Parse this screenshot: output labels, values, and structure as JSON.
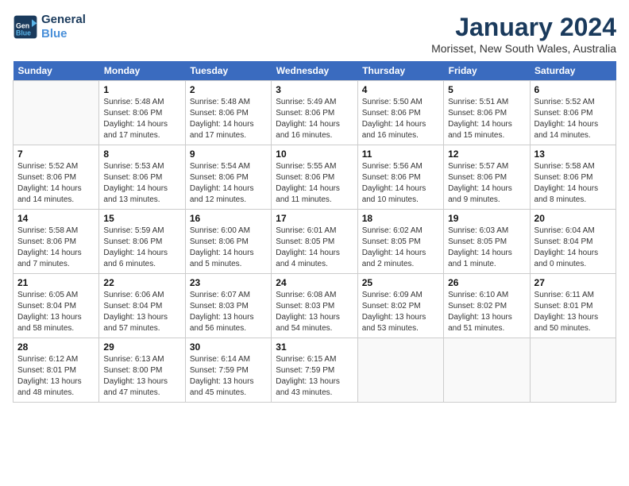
{
  "logo": {
    "line1": "General",
    "line2": "Blue"
  },
  "title": "January 2024",
  "location": "Morisset, New South Wales, Australia",
  "days_of_week": [
    "Sunday",
    "Monday",
    "Tuesday",
    "Wednesday",
    "Thursday",
    "Friday",
    "Saturday"
  ],
  "weeks": [
    [
      {
        "num": "",
        "info": ""
      },
      {
        "num": "1",
        "info": "Sunrise: 5:48 AM\nSunset: 8:06 PM\nDaylight: 14 hours\nand 17 minutes."
      },
      {
        "num": "2",
        "info": "Sunrise: 5:48 AM\nSunset: 8:06 PM\nDaylight: 14 hours\nand 17 minutes."
      },
      {
        "num": "3",
        "info": "Sunrise: 5:49 AM\nSunset: 8:06 PM\nDaylight: 14 hours\nand 16 minutes."
      },
      {
        "num": "4",
        "info": "Sunrise: 5:50 AM\nSunset: 8:06 PM\nDaylight: 14 hours\nand 16 minutes."
      },
      {
        "num": "5",
        "info": "Sunrise: 5:51 AM\nSunset: 8:06 PM\nDaylight: 14 hours\nand 15 minutes."
      },
      {
        "num": "6",
        "info": "Sunrise: 5:52 AM\nSunset: 8:06 PM\nDaylight: 14 hours\nand 14 minutes."
      }
    ],
    [
      {
        "num": "7",
        "info": "Sunrise: 5:52 AM\nSunset: 8:06 PM\nDaylight: 14 hours\nand 14 minutes."
      },
      {
        "num": "8",
        "info": "Sunrise: 5:53 AM\nSunset: 8:06 PM\nDaylight: 14 hours\nand 13 minutes."
      },
      {
        "num": "9",
        "info": "Sunrise: 5:54 AM\nSunset: 8:06 PM\nDaylight: 14 hours\nand 12 minutes."
      },
      {
        "num": "10",
        "info": "Sunrise: 5:55 AM\nSunset: 8:06 PM\nDaylight: 14 hours\nand 11 minutes."
      },
      {
        "num": "11",
        "info": "Sunrise: 5:56 AM\nSunset: 8:06 PM\nDaylight: 14 hours\nand 10 minutes."
      },
      {
        "num": "12",
        "info": "Sunrise: 5:57 AM\nSunset: 8:06 PM\nDaylight: 14 hours\nand 9 minutes."
      },
      {
        "num": "13",
        "info": "Sunrise: 5:58 AM\nSunset: 8:06 PM\nDaylight: 14 hours\nand 8 minutes."
      }
    ],
    [
      {
        "num": "14",
        "info": "Sunrise: 5:58 AM\nSunset: 8:06 PM\nDaylight: 14 hours\nand 7 minutes."
      },
      {
        "num": "15",
        "info": "Sunrise: 5:59 AM\nSunset: 8:06 PM\nDaylight: 14 hours\nand 6 minutes."
      },
      {
        "num": "16",
        "info": "Sunrise: 6:00 AM\nSunset: 8:06 PM\nDaylight: 14 hours\nand 5 minutes."
      },
      {
        "num": "17",
        "info": "Sunrise: 6:01 AM\nSunset: 8:05 PM\nDaylight: 14 hours\nand 4 minutes."
      },
      {
        "num": "18",
        "info": "Sunrise: 6:02 AM\nSunset: 8:05 PM\nDaylight: 14 hours\nand 2 minutes."
      },
      {
        "num": "19",
        "info": "Sunrise: 6:03 AM\nSunset: 8:05 PM\nDaylight: 14 hours\nand 1 minute."
      },
      {
        "num": "20",
        "info": "Sunrise: 6:04 AM\nSunset: 8:04 PM\nDaylight: 14 hours\nand 0 minutes."
      }
    ],
    [
      {
        "num": "21",
        "info": "Sunrise: 6:05 AM\nSunset: 8:04 PM\nDaylight: 13 hours\nand 58 minutes."
      },
      {
        "num": "22",
        "info": "Sunrise: 6:06 AM\nSunset: 8:04 PM\nDaylight: 13 hours\nand 57 minutes."
      },
      {
        "num": "23",
        "info": "Sunrise: 6:07 AM\nSunset: 8:03 PM\nDaylight: 13 hours\nand 56 minutes."
      },
      {
        "num": "24",
        "info": "Sunrise: 6:08 AM\nSunset: 8:03 PM\nDaylight: 13 hours\nand 54 minutes."
      },
      {
        "num": "25",
        "info": "Sunrise: 6:09 AM\nSunset: 8:02 PM\nDaylight: 13 hours\nand 53 minutes."
      },
      {
        "num": "26",
        "info": "Sunrise: 6:10 AM\nSunset: 8:02 PM\nDaylight: 13 hours\nand 51 minutes."
      },
      {
        "num": "27",
        "info": "Sunrise: 6:11 AM\nSunset: 8:01 PM\nDaylight: 13 hours\nand 50 minutes."
      }
    ],
    [
      {
        "num": "28",
        "info": "Sunrise: 6:12 AM\nSunset: 8:01 PM\nDaylight: 13 hours\nand 48 minutes."
      },
      {
        "num": "29",
        "info": "Sunrise: 6:13 AM\nSunset: 8:00 PM\nDaylight: 13 hours\nand 47 minutes."
      },
      {
        "num": "30",
        "info": "Sunrise: 6:14 AM\nSunset: 7:59 PM\nDaylight: 13 hours\nand 45 minutes."
      },
      {
        "num": "31",
        "info": "Sunrise: 6:15 AM\nSunset: 7:59 PM\nDaylight: 13 hours\nand 43 minutes."
      },
      {
        "num": "",
        "info": ""
      },
      {
        "num": "",
        "info": ""
      },
      {
        "num": "",
        "info": ""
      }
    ]
  ]
}
